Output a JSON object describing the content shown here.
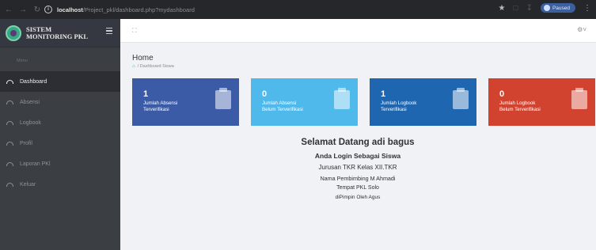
{
  "browser": {
    "url_host": "localhost",
    "url_path": "/Project_pkl/dashboard.php?mydashboard",
    "profile_label": "Paused"
  },
  "sidebar": {
    "brand_line1": "SISTEM",
    "brand_line2": "MONITORING PKL",
    "menu_title": "Menu",
    "items": [
      {
        "label": "Dashboard",
        "icon": "dashboard-icon",
        "active": true
      },
      {
        "label": "Absensi",
        "icon": "absensi-icon",
        "active": false
      },
      {
        "label": "Logbook",
        "icon": "logbook-icon",
        "active": false
      },
      {
        "label": "Profil",
        "icon": "profile-icon",
        "active": false
      },
      {
        "label": "Laporan PKl",
        "icon": "report-icon",
        "active": false
      },
      {
        "label": "Keluar",
        "icon": "logout-icon",
        "active": false
      }
    ]
  },
  "main": {
    "title": "Home",
    "breadcrumb": "/ Dashboard Siswa",
    "cards": [
      {
        "value": "1",
        "label_line1": "Jumlah Absensi",
        "label_line2": "Terverifikasi",
        "color": "#3b5ba6",
        "icon": "calendar-check-icon"
      },
      {
        "value": "0",
        "label_line1": "Jumlah Absensi",
        "label_line2": "Belum Terverifikasi",
        "color": "#4fb9ec",
        "icon": "calendar-x-icon"
      },
      {
        "value": "1",
        "label_line1": "Jumlah Logbook",
        "label_line2": "Terverifikasi",
        "color": "#1f66b0",
        "icon": "clipboard-check-icon"
      },
      {
        "value": "0",
        "label_line1": "Jumlah Logbook",
        "label_line2": "Belum Terverifikasi",
        "color": "#d2432f",
        "icon": "clipboard-icon"
      }
    ],
    "welcome": {
      "greeting": "Selamat Datang adi bagus",
      "login_as": "Anda Login Sebagai Siswa",
      "jurusan": "Jurusan TKR Kelas XII.TKR",
      "pembimbing": "Nama Pembimbing M Ahmadi",
      "tempat": "Tempat PKL Solo",
      "pimpin": "diPimpin Oleh Agus"
    }
  }
}
